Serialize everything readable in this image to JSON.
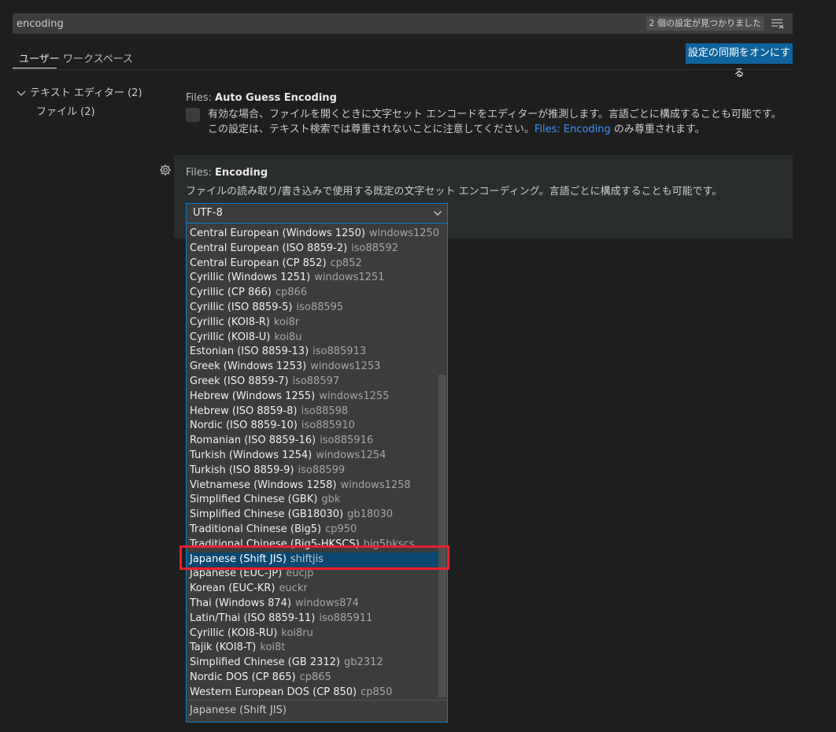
{
  "search": {
    "value": "encoding",
    "result_count": "2 個の設定が見つかりました"
  },
  "tabs": {
    "user": "ユーザー",
    "workspace": "ワークスペース"
  },
  "sync_button": "設定の同期をオンにする",
  "toc": {
    "group": "テキスト エディター (2)",
    "item": "ファイル (2)"
  },
  "settings": [
    {
      "category": "Files: ",
      "name": "Auto Guess Encoding",
      "description": "有効な場合、ファイルを開くときに文字セット エンコードをエディターが推測します。言語ごとに構成することも可能です。この設定は、テキスト検索では尊重されないことに注意してください。",
      "link": "Files: Encoding",
      "description_tail": " のみ尊重されます。",
      "checked": false
    },
    {
      "category": "Files: ",
      "name": "Encoding",
      "description": "ファイルの読み取り/書き込みで使用する既定の文字セット エンコーディング。言語ごとに構成することも可能です。",
      "value": "UTF-8"
    }
  ],
  "dropdown": {
    "options": [
      {
        "label": "Central European (Windows 1250)",
        "alias": "windows1250"
      },
      {
        "label": "Central European (ISO 8859-2)",
        "alias": "iso88592"
      },
      {
        "label": "Central European (CP 852)",
        "alias": "cp852"
      },
      {
        "label": "Cyrillic (Windows 1251)",
        "alias": "windows1251"
      },
      {
        "label": "Cyrillic (CP 866)",
        "alias": "cp866"
      },
      {
        "label": "Cyrillic (ISO 8859-5)",
        "alias": "iso88595"
      },
      {
        "label": "Cyrillic (KOI8-R)",
        "alias": "koi8r"
      },
      {
        "label": "Cyrillic (KOI8-U)",
        "alias": "koi8u"
      },
      {
        "label": "Estonian (ISO 8859-13)",
        "alias": "iso885913"
      },
      {
        "label": "Greek (Windows 1253)",
        "alias": "windows1253"
      },
      {
        "label": "Greek (ISO 8859-7)",
        "alias": "iso88597"
      },
      {
        "label": "Hebrew (Windows 1255)",
        "alias": "windows1255"
      },
      {
        "label": "Hebrew (ISO 8859-8)",
        "alias": "iso88598"
      },
      {
        "label": "Nordic (ISO 8859-10)",
        "alias": "iso885910"
      },
      {
        "label": "Romanian (ISO 8859-16)",
        "alias": "iso885916"
      },
      {
        "label": "Turkish (Windows 1254)",
        "alias": "windows1254"
      },
      {
        "label": "Turkish (ISO 8859-9)",
        "alias": "iso88599"
      },
      {
        "label": "Vietnamese (Windows 1258)",
        "alias": "windows1258"
      },
      {
        "label": "Simplified Chinese (GBK)",
        "alias": "gbk"
      },
      {
        "label": "Simplified Chinese (GB18030)",
        "alias": "gb18030"
      },
      {
        "label": "Traditional Chinese (Big5)",
        "alias": "cp950"
      },
      {
        "label": "Traditional Chinese (Big5-HKSCS)",
        "alias": "big5hkscs"
      },
      {
        "label": "Japanese (Shift JIS)",
        "alias": "shiftjis",
        "selected": true
      },
      {
        "label": "Japanese (EUC-JP)",
        "alias": "eucjp"
      },
      {
        "label": "Korean (EUC-KR)",
        "alias": "euckr"
      },
      {
        "label": "Thai (Windows 874)",
        "alias": "windows874"
      },
      {
        "label": "Latin/Thai (ISO 8859-11)",
        "alias": "iso885911"
      },
      {
        "label": "Cyrillic (KOI8-RU)",
        "alias": "koi8ru"
      },
      {
        "label": "Tajik (KOI8-T)",
        "alias": "koi8t"
      },
      {
        "label": "Simplified Chinese (GB 2312)",
        "alias": "gb2312"
      },
      {
        "label": "Nordic DOS (CP 865)",
        "alias": "cp865"
      },
      {
        "label": "Western European DOS (CP 850)",
        "alias": "cp850"
      }
    ],
    "footer_label": "Japanese (Shift JIS)"
  },
  "colors": {
    "background": "#1e1e1e",
    "accent": "#0e639c",
    "focus_border": "#007fd4",
    "selected_option": "#094771",
    "highlight_annotation": "#e8212d",
    "link": "#3794ff"
  },
  "icons": {
    "filter": "clear-filter-icon",
    "gear": "gear-icon",
    "chevron": "chevron-down-icon"
  }
}
